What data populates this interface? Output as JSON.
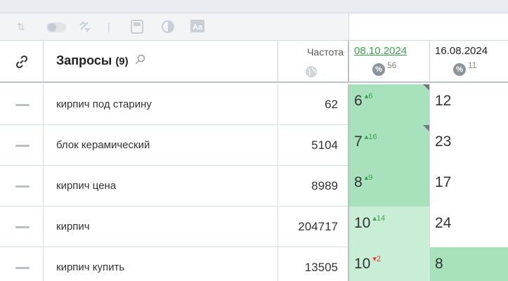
{
  "toolbar": {
    "icons": [
      "sort-icon",
      "toggle-icon",
      "link-off-icon",
      "divider-icon",
      "calculator-icon",
      "contrast-icon",
      "text-style-icon"
    ]
  },
  "header": {
    "queries_title": "Запросы",
    "queries_count": "(9)",
    "frequency_label": "Частота",
    "dates": [
      {
        "date": "08.10.2024",
        "percent_icon": "%",
        "percent": "56",
        "style": "link"
      },
      {
        "date": "16.08.2024",
        "percent_icon": "%",
        "percent": "11",
        "style": "plain"
      }
    ]
  },
  "colors": {
    "dark_green": "#a8e2bd",
    "light_green": "#c8eed6",
    "up": "#3aa24f",
    "down": "#e53935"
  },
  "rows": [
    {
      "query": "кирпич под старину",
      "freq": "62",
      "pos1": "6",
      "delta1": "6",
      "dir1": "up",
      "bg1": "#a8e2bd",
      "corner1": true,
      "pos2": "12",
      "bg2": "#ffffff"
    },
    {
      "query": "блок керамический",
      "freq": "5104",
      "pos1": "7",
      "delta1": "16",
      "dir1": "up",
      "bg1": "#a8e2bd",
      "corner1": true,
      "pos2": "23",
      "bg2": "#ffffff"
    },
    {
      "query": "кирпич цена",
      "freq": "8989",
      "pos1": "8",
      "delta1": "9",
      "dir1": "up",
      "bg1": "#a8e2bd",
      "corner1": false,
      "pos2": "17",
      "bg2": "#ffffff"
    },
    {
      "query": "кирпич",
      "freq": "204717",
      "pos1": "10",
      "delta1": "14",
      "dir1": "up",
      "bg1": "#c8eed6",
      "corner1": false,
      "pos2": "24",
      "bg2": "#ffffff"
    },
    {
      "query": "кирпич купить",
      "freq": "13505",
      "pos1": "10",
      "delta1": "2",
      "dir1": "down",
      "bg1": "#c8eed6",
      "corner1": false,
      "pos2": "8",
      "bg2": "#a8e2bd"
    }
  ]
}
